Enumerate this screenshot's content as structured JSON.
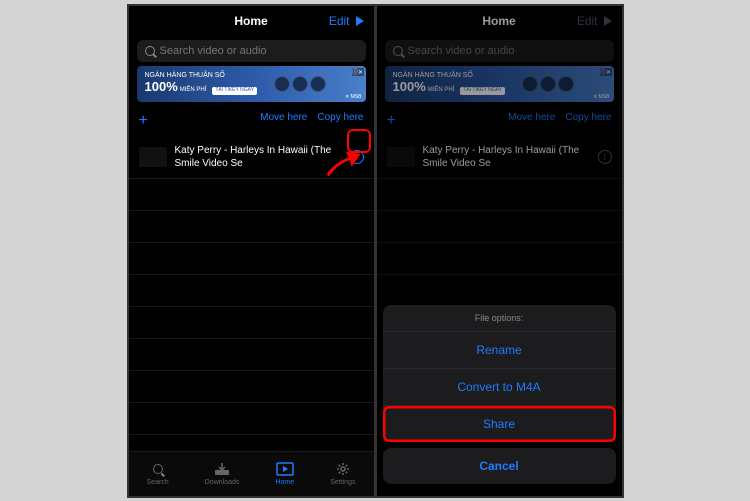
{
  "header": {
    "title": "Home",
    "edit": "Edit"
  },
  "search": {
    "placeholder": "Search video or audio"
  },
  "banner": {
    "line1": "NGÀN HÀNG THUẬN SỐ",
    "percent": "100%",
    "sub": "MIỄN PHÍ",
    "badge": "TẢI TIKEY NGAY",
    "brand": "✕ MSB"
  },
  "actions": {
    "move": "Move here",
    "copy": "Copy here"
  },
  "item": {
    "title": "Katy Perry - Harleys In Hawaii (The Smile Video Se"
  },
  "tabs": {
    "search": "Search",
    "downloads": "Downloads",
    "home": "Home",
    "settings": "Settings"
  },
  "sheet": {
    "title": "File options:",
    "rename": "Rename",
    "convert": "Convert to M4A",
    "share": "Share",
    "cancel": "Cancel"
  }
}
